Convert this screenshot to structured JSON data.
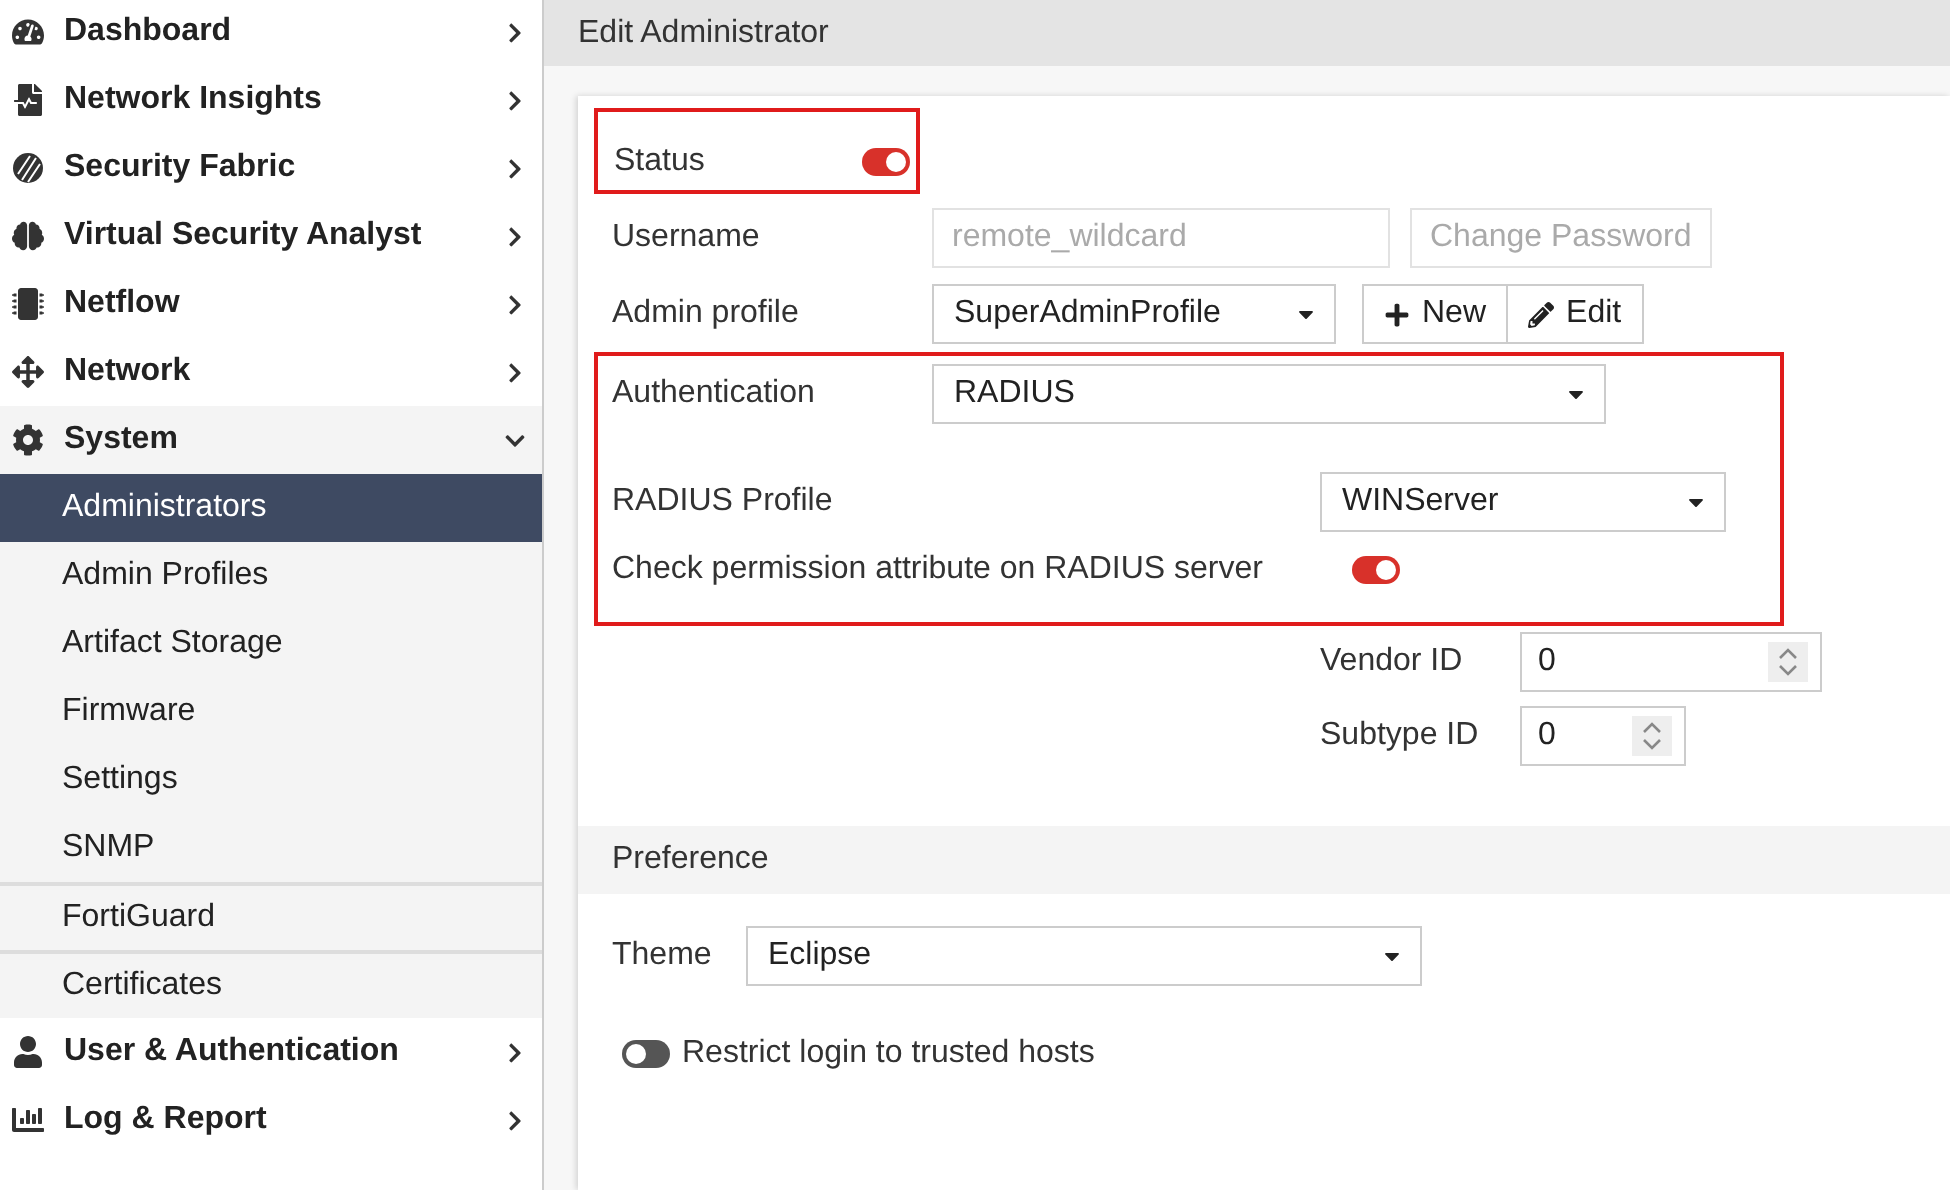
{
  "sidebar": {
    "items": [
      {
        "label": "Dashboard",
        "expanded": false
      },
      {
        "label": "Network Insights",
        "expanded": false
      },
      {
        "label": "Security Fabric",
        "expanded": false
      },
      {
        "label": "Virtual Security Analyst",
        "expanded": false
      },
      {
        "label": "Netflow",
        "expanded": false
      },
      {
        "label": "Network",
        "expanded": false
      },
      {
        "label": "System",
        "expanded": true,
        "children": [
          {
            "label": "Administrators",
            "selected": true,
            "divider_above": false
          },
          {
            "label": "Admin Profiles",
            "selected": false,
            "divider_above": false
          },
          {
            "label": "Artifact Storage",
            "selected": false,
            "divider_above": false
          },
          {
            "label": "Firmware",
            "selected": false,
            "divider_above": false
          },
          {
            "label": "Settings",
            "selected": false,
            "divider_above": false
          },
          {
            "label": "SNMP",
            "selected": false,
            "divider_above": false
          },
          {
            "label": "FortiGuard",
            "selected": false,
            "divider_above": true
          },
          {
            "label": "Certificates",
            "selected": false,
            "divider_above": true
          }
        ]
      },
      {
        "label": "User & Authentication",
        "expanded": false
      },
      {
        "label": "Log & Report",
        "expanded": false
      }
    ]
  },
  "page_title": "Edit Administrator",
  "form": {
    "status": {
      "label": "Status",
      "on": true
    },
    "username": {
      "label": "Username",
      "value": "remote_wildcard",
      "disabled": true,
      "button": {
        "label": "Change Password",
        "disabled": true
      }
    },
    "admin_profile": {
      "label": "Admin profile",
      "value": "SuperAdminProfile",
      "buttons": [
        {
          "label": "New"
        },
        {
          "label": "Edit"
        }
      ]
    },
    "authentication": {
      "label": "Authentication",
      "value": "RADIUS"
    },
    "radius_profile": {
      "label": "RADIUS Profile",
      "value": "WINServer"
    },
    "check_permission": {
      "label": "Check permission attribute on RADIUS server",
      "on": true
    },
    "vendor_id": {
      "label": "Vendor ID",
      "value": "0"
    },
    "subtype_id": {
      "label": "Subtype ID",
      "value": "0"
    }
  },
  "preference": {
    "title": "Preference",
    "theme": {
      "label": "Theme",
      "value": "Eclipse"
    },
    "restrict_login": {
      "label": "Restrict login to trusted hosts",
      "on": false
    }
  }
}
